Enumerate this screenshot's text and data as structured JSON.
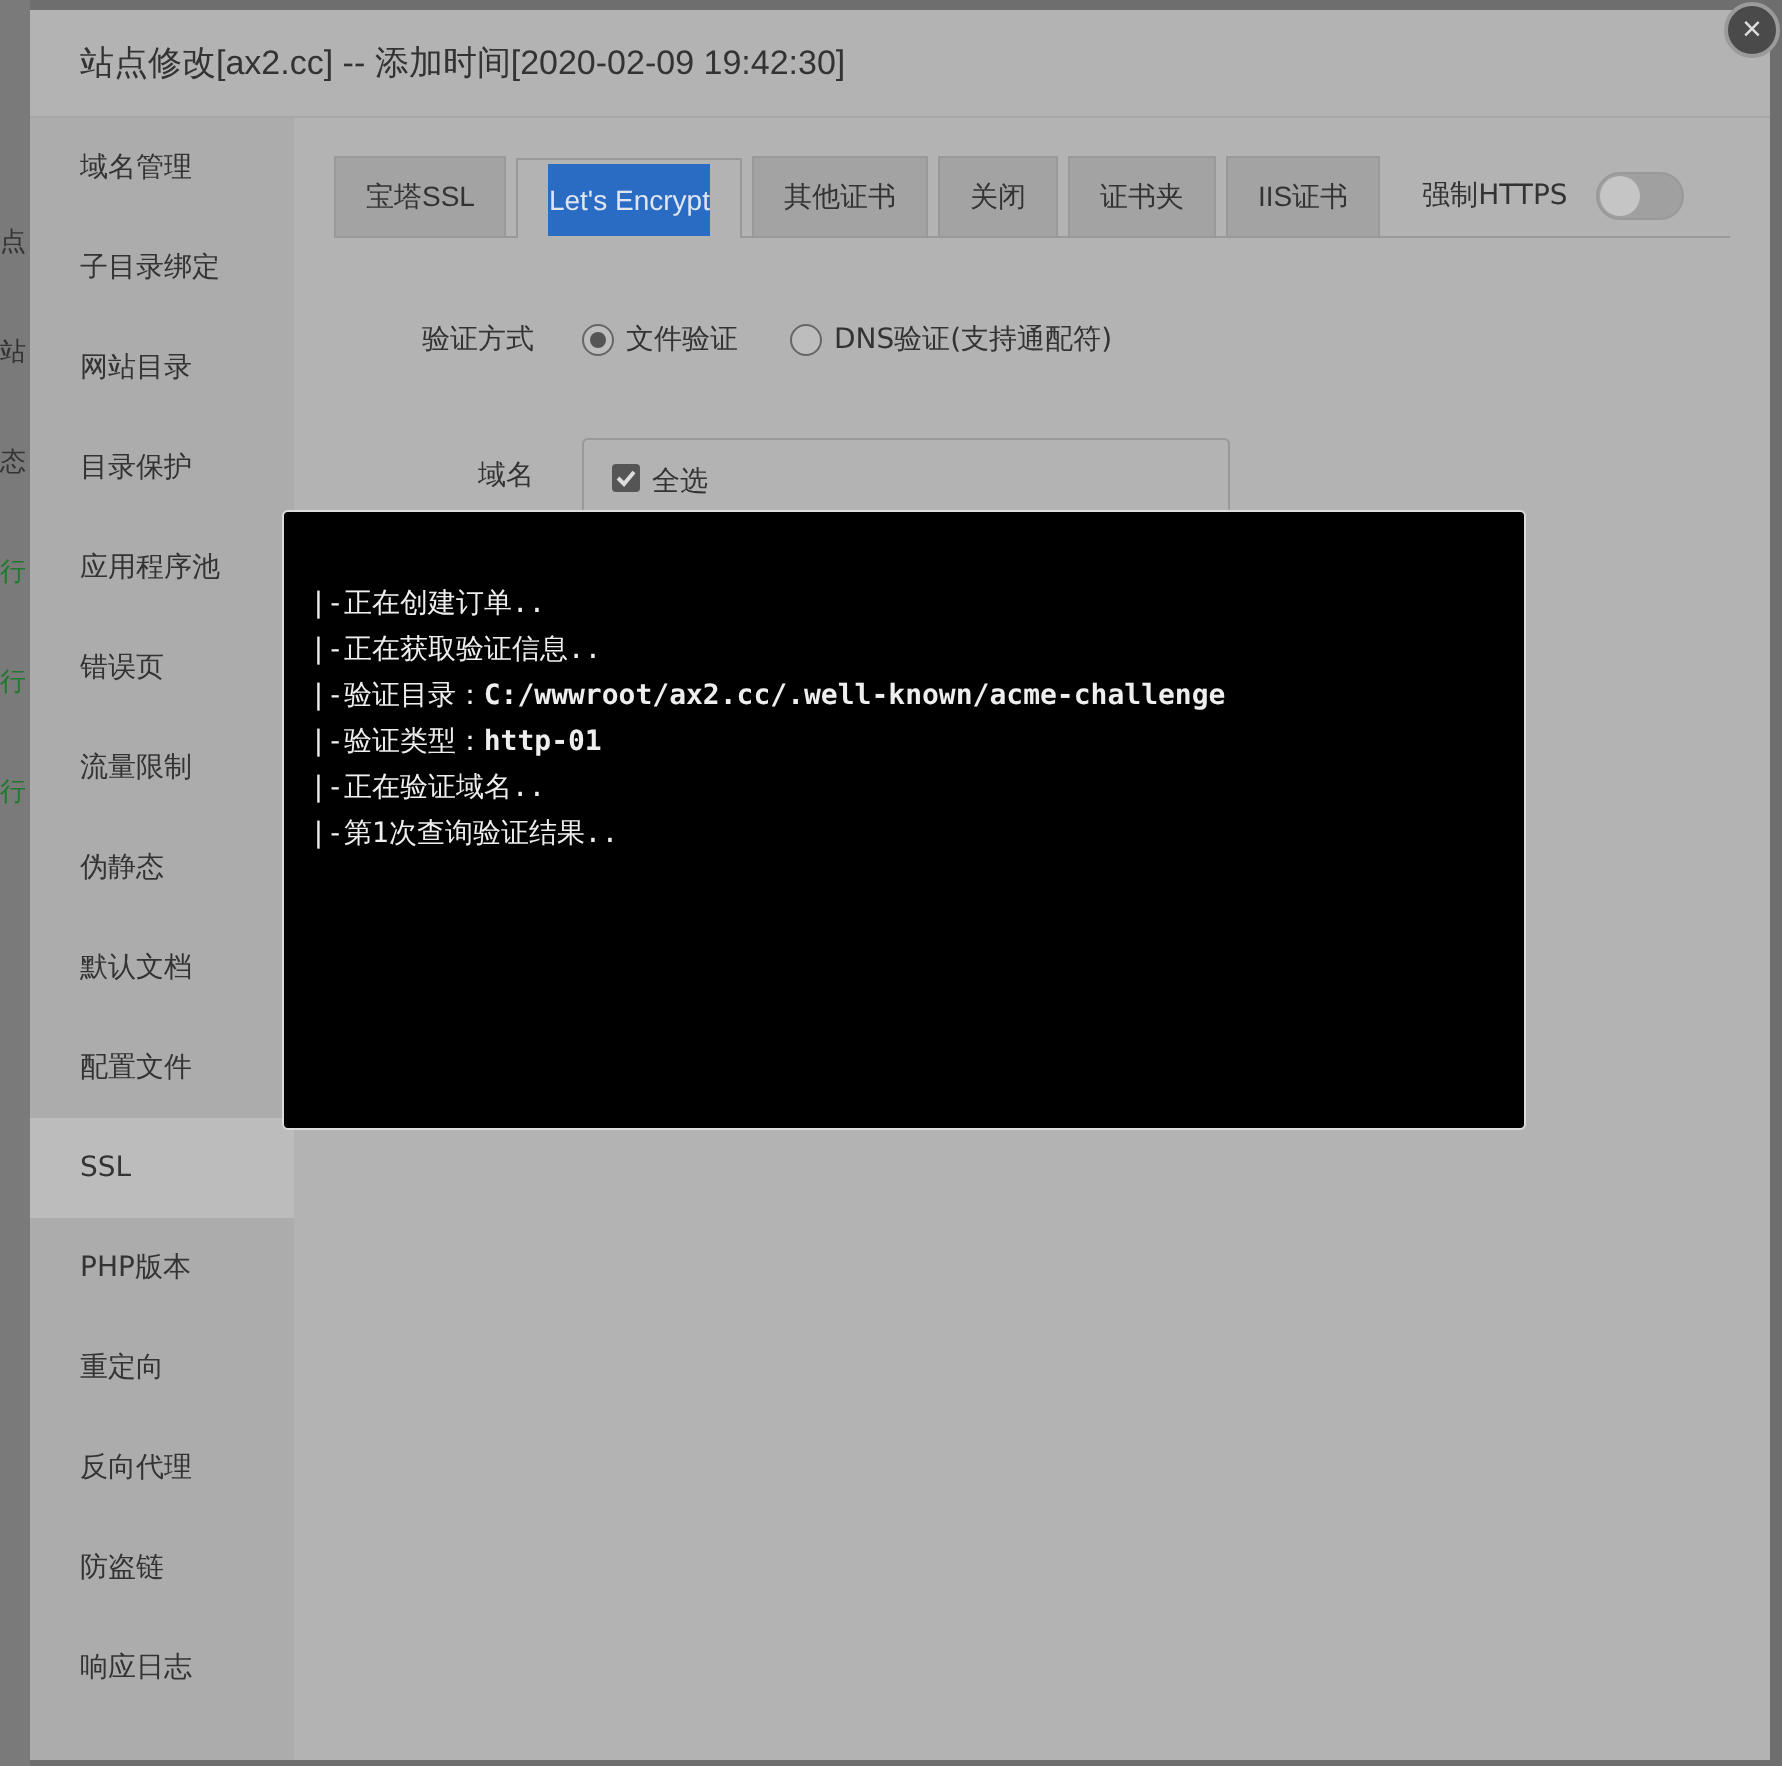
{
  "background_page": {
    "fragments": [
      {
        "text": "点",
        "color": "#333333"
      },
      {
        "text": "站",
        "color": "#333333"
      },
      {
        "text": "态",
        "color": "#333333"
      },
      {
        "text": "行",
        "color": "#1f7a2e"
      },
      {
        "text": "行",
        "color": "#1f7a2e"
      },
      {
        "text": "行",
        "color": "#1f7a2e"
      }
    ]
  },
  "dialog": {
    "title": "站点修改[ax2.cc] -- 添加时间[2020-02-09 19:42:30]",
    "close": "×"
  },
  "sidebar": {
    "items": [
      {
        "label": "域名管理",
        "selected": false
      },
      {
        "label": "子目录绑定",
        "selected": false
      },
      {
        "label": "网站目录",
        "selected": false
      },
      {
        "label": "目录保护",
        "selected": false
      },
      {
        "label": "应用程序池",
        "selected": false
      },
      {
        "label": "错误页",
        "selected": false
      },
      {
        "label": "流量限制",
        "selected": false
      },
      {
        "label": "伪静态",
        "selected": false
      },
      {
        "label": "默认文档",
        "selected": false
      },
      {
        "label": "配置文件",
        "selected": false
      },
      {
        "label": "SSL",
        "selected": true
      },
      {
        "label": "PHP版本",
        "selected": false
      },
      {
        "label": "重定向",
        "selected": false
      },
      {
        "label": "反向代理",
        "selected": false
      },
      {
        "label": "防盗链",
        "selected": false
      },
      {
        "label": "响应日志",
        "selected": false
      }
    ]
  },
  "tabs": [
    {
      "label": "宝塔SSL",
      "selected": false
    },
    {
      "label": "Let's Encrypt",
      "selected": true
    },
    {
      "label": "其他证书",
      "selected": false
    },
    {
      "label": "关闭",
      "selected": false
    },
    {
      "label": "证书夹",
      "selected": false
    },
    {
      "label": "IIS证书",
      "selected": false
    }
  ],
  "force_https": {
    "label": "强制HTTPS",
    "on": false
  },
  "verify_method": {
    "label": "验证方式",
    "options": [
      {
        "label": "文件验证",
        "selected": true
      },
      {
        "label": "DNS验证(支持通配符)",
        "selected": false
      }
    ]
  },
  "domain": {
    "label": "域名",
    "select_all": {
      "label": "全选",
      "checked": true
    }
  },
  "terminal": {
    "lines": [
      {
        "prefix": "|-正在创建订单.."
      },
      {
        "prefix": "|-正在获取验证信息.."
      },
      {
        "prefix": "|-验证目录：",
        "value": "C:/wwwroot/ax2.cc/.well-known/acme-challenge"
      },
      {
        "prefix": "|-验证类型：",
        "value": "http-01"
      },
      {
        "prefix": "|-正在验证域名.."
      },
      {
        "prefix": "|-第1次查询验证结果.."
      }
    ]
  }
}
